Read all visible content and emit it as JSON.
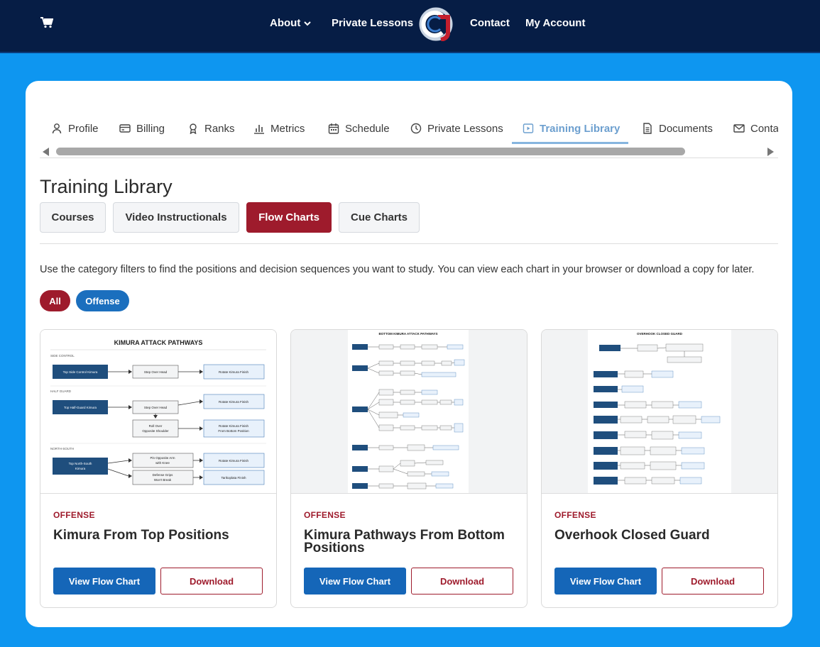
{
  "nav": {
    "about": "About",
    "private_lessons": "Private Lessons",
    "contact": "Contact",
    "my_account": "My Account"
  },
  "tabs": [
    {
      "label": "Profile",
      "icon": "user-icon"
    },
    {
      "label": "Billing",
      "icon": "credit-card-icon"
    },
    {
      "label": "Ranks",
      "icon": "award-icon"
    },
    {
      "label": "Metrics",
      "icon": "bar-chart-icon"
    },
    {
      "label": "Schedule",
      "icon": "calendar-icon"
    },
    {
      "label": "Private Lessons",
      "icon": "clock-icon"
    },
    {
      "label": "Training Library",
      "icon": "play-icon",
      "active": true
    },
    {
      "label": "Documents",
      "icon": "document-icon"
    },
    {
      "label": "Conta",
      "icon": "mail-icon"
    }
  ],
  "page_title": "Training Library",
  "sub_tabs": [
    {
      "label": "Courses"
    },
    {
      "label": "Video Instructionals"
    },
    {
      "label": "Flow Charts",
      "active": true
    },
    {
      "label": "Cue Charts"
    }
  ],
  "description": "Use the category filters to find the positions and decision sequences you want to study. You can view each chart in your browser or download a copy for later.",
  "filters": [
    {
      "label": "All",
      "color": "#9e1b2c"
    },
    {
      "label": "Offense",
      "color": "#1b6fbe"
    }
  ],
  "cards": [
    {
      "category": "OFFENSE",
      "title": "Kimura From Top Positions",
      "view_label": "View Flow Chart",
      "download_label": "Download",
      "thumb": {
        "heading": "KIMURA ATTACK PATHWAYS",
        "sections": [
          "SIDE CONTROL",
          "HALF GUARD",
          "NORTH-SOUTH"
        ],
        "nodes": {
          "sc_start": "Top Side Control Kimura",
          "sc_step": "Step Over Head",
          "sc_finish": "Rotate Kimura Finish",
          "hg_start": "Top Half-Guard Kimura",
          "hg_step": "Step Over Head",
          "hg_finish1": "Rotate Kimura Finish",
          "hg_roll1": "Roll Over",
          "hg_roll2": "Opposite Shoulder",
          "hg_finish2a": "Rotate Kimura Finish",
          "hg_finish2b": "From Bottom Position",
          "ns_start1": "Top North-South",
          "ns_start2": "Kimura",
          "ns_pin1": "Pin Opposite Arm",
          "ns_pin2": "with Knee",
          "ns_def1": "Defense Grips",
          "ns_def2": "Won't Break",
          "ns_finish1": "Rotate Kimura Finish",
          "ns_finish2": "Tarikoplata Finish"
        }
      }
    },
    {
      "category": "OFFENSE",
      "title": "Kimura Pathways From Bottom Positions",
      "view_label": "View Flow Chart",
      "download_label": "Download",
      "thumb": {
        "heading": "BOTTOM KIMURA ATTACK PATHWAYS"
      }
    },
    {
      "category": "OFFENSE",
      "title": "Overhook Closed Guard",
      "view_label": "View Flow Chart",
      "download_label": "Download",
      "thumb": {
        "heading": "OVERHOOK CLOSED GUARD"
      }
    }
  ],
  "colors": {
    "navy": "#061d45",
    "background_blue": "#0e96f0",
    "accent_red": "#9e1b2c",
    "button_blue": "#1566b8",
    "node_dark": "#1f4e7d",
    "node_light": "#e8f1fb"
  }
}
